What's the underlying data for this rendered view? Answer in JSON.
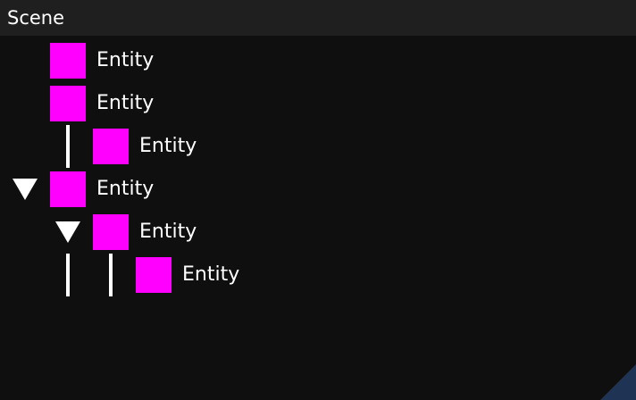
{
  "header": {
    "title": "Scene"
  },
  "tree": {
    "rows": [
      {
        "label": "Entity",
        "depth": 1,
        "expanded": null
      },
      {
        "label": "Entity",
        "depth": 1,
        "expanded": null
      },
      {
        "label": "Entity",
        "depth": 2,
        "expanded": null
      },
      {
        "label": "Entity",
        "depth": 1,
        "expanded": true
      },
      {
        "label": "Entity",
        "depth": 2,
        "expanded": true
      },
      {
        "label": "Entity",
        "depth": 3,
        "expanded": null
      }
    ]
  },
  "colors": {
    "entity_icon": "#ff00ff",
    "background": "#0f0f0f",
    "header_background": "#1f1f1f",
    "text": "#ffffff",
    "corner_accent": "#1f3354"
  }
}
